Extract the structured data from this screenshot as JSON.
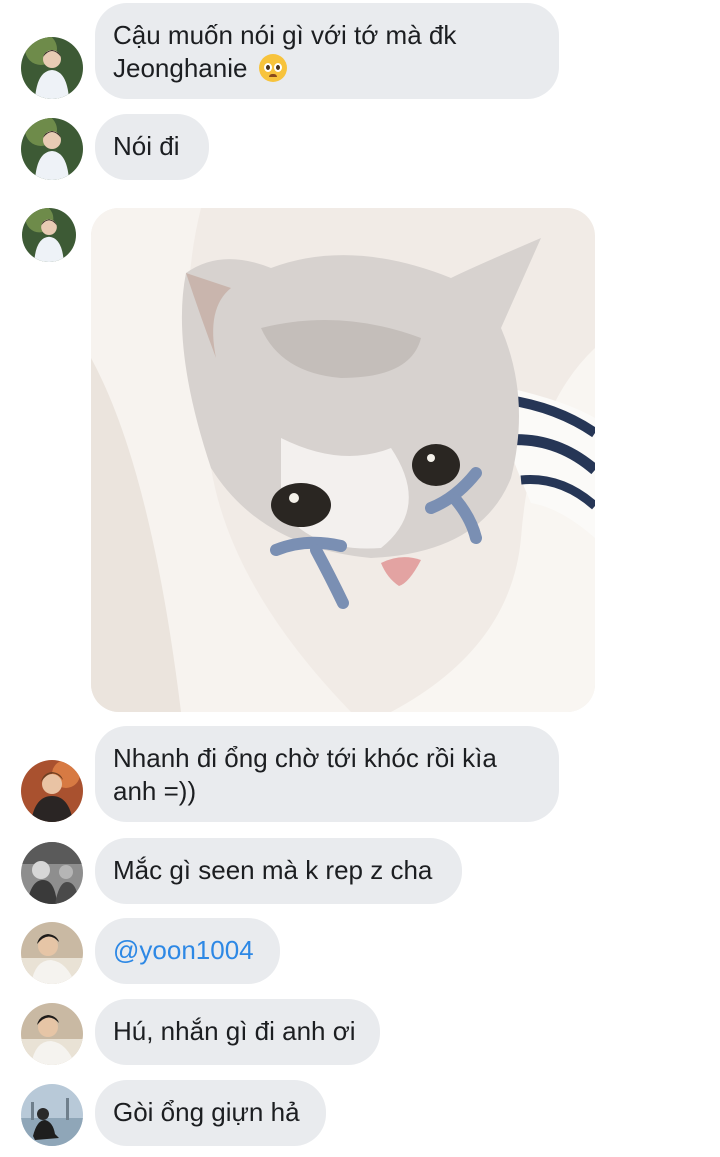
{
  "messages": [
    {
      "type": "text",
      "text": "Cậu muốn nói gì với tớ mà đk Jeonghanie",
      "emoji": "pleading-face-emoji"
    },
    {
      "type": "text",
      "text": "Nói đi"
    },
    {
      "type": "image",
      "image": "crying-cat-photo"
    },
    {
      "type": "text",
      "text": "Nhanh đi ổng chờ tới khóc rồi kìa anh =))"
    },
    {
      "type": "text",
      "text": "Mắc gì seen mà k rep z cha"
    },
    {
      "type": "mention",
      "text": "@yoon1004"
    },
    {
      "type": "text",
      "text": "Hú, nhắn gì đi anh ơi"
    },
    {
      "type": "text",
      "text": "Gòi ổng giựn hả"
    }
  ],
  "colors": {
    "bubble_bg": "#e9ebee",
    "text": "#1c1e21",
    "mention": "#2d88e5",
    "background": "#ffffff"
  }
}
